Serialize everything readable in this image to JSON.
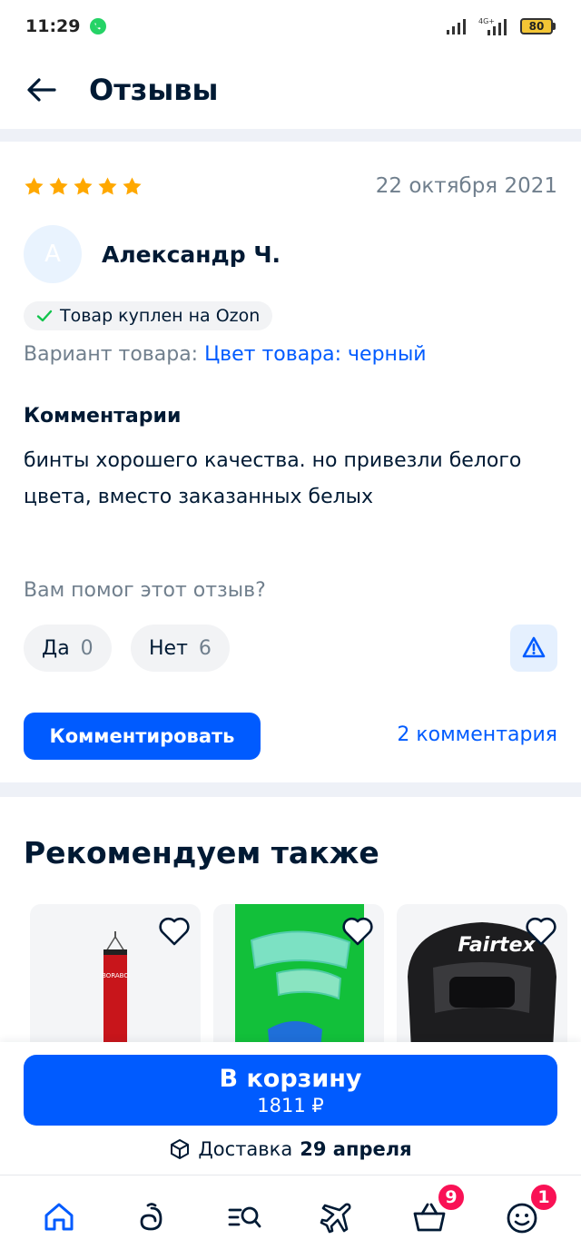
{
  "status": {
    "time": "11:29",
    "battery": "80",
    "network": "4G+"
  },
  "header": {
    "title": "Отзывы"
  },
  "review": {
    "rating": 5,
    "date": "22 октября 2021",
    "avatar_letter": "A",
    "author": "Александр Ч.",
    "bought_badge": "Товар куплен на Ozon",
    "variant_label": "Вариант товара:",
    "variant_value": "Цвет товара: черный",
    "comment_title": "Комментарии",
    "comment_text": "бинты хорошего качества. но привезли белого цвета, вместо заказанных белых",
    "helpful_question": "Вам помог этот отзыв?",
    "yes_label": "Да",
    "yes_count": "0",
    "no_label": "Нет",
    "no_count": "6",
    "comment_button": "Комментировать",
    "comments_link": "2 комментария"
  },
  "recommend": {
    "title": "Рекомендуем также",
    "products": [
      {
        "brand_text": "BORABO"
      },
      {
        "brand_text": ""
      },
      {
        "brand_text": "Fairtex"
      }
    ]
  },
  "cart": {
    "label": "В корзину",
    "price": "1811 ₽",
    "delivery_label": "Доставка",
    "delivery_date": "29 апреля"
  },
  "tabbar": {
    "cart_badge": "9",
    "profile_badge": "1"
  },
  "colors": {
    "accent": "#005bff",
    "star": "#ffa800",
    "badge": "#f91155",
    "text": "#001a34",
    "muted": "#707f8d"
  }
}
